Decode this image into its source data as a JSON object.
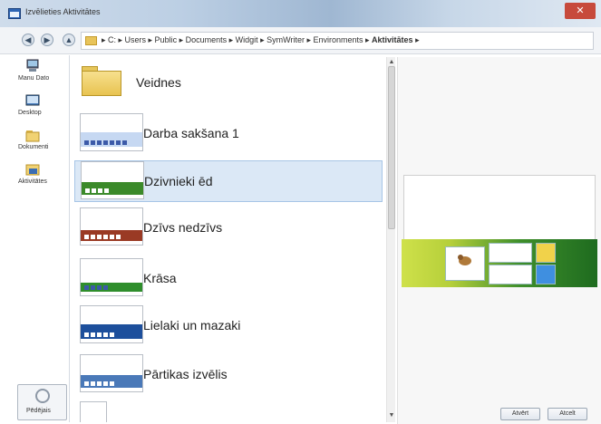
{
  "window": {
    "title": "Izvēlieties Aktivitātes",
    "close_label": "✕"
  },
  "nav": {
    "back_icon": "back-arrow-icon",
    "forward_icon": "forward-arrow-icon",
    "up_icon": "up-arrow-icon",
    "breadcrumb": [
      "C:",
      "Users",
      "Public",
      "Documents",
      "Widgit",
      "SymWriter",
      "Environments",
      "Aktivitātes"
    ],
    "path_text": "▸ C: ▸ Users ▸ Public ▸ Documents ▸ Widgit ▸ SymWriter ▸ Environments ▸ ",
    "current": "Aktivitātes",
    "trailing": " ▸"
  },
  "sidebar": {
    "items": [
      {
        "label": "Manu Dato",
        "icon": "computer-icon"
      },
      {
        "label": "Desktop",
        "icon": "desktop-icon"
      },
      {
        "label": "Dokumenti",
        "icon": "documents-folder-icon"
      },
      {
        "label": "Aktivitātes",
        "icon": "activities-icon"
      }
    ],
    "bottom_label": "Pēdējais"
  },
  "files": [
    {
      "label": "Veidnes",
      "type": "folder"
    },
    {
      "label": "Darba sakšana 1",
      "type": "file",
      "band": "#c6d8f2"
    },
    {
      "label": "Dzivnieki ēd",
      "type": "file",
      "band": "#3b8a2a",
      "selected": true
    },
    {
      "label": "Dzīvs nedzīvs",
      "type": "file",
      "band": "#9a3a24"
    },
    {
      "label": "Krāsa",
      "type": "file",
      "band": "#2f8e2c"
    },
    {
      "label": "Lielaki un mazaki",
      "type": "file",
      "band": "#1d4f9c"
    },
    {
      "label": "Pārtikas izvēlis",
      "type": "file",
      "band": "#4a79b8"
    },
    {
      "label": "",
      "type": "file",
      "band": "#d9d9d9"
    }
  ],
  "buttons": {
    "open": "Atvērt",
    "cancel": "Atcelt"
  },
  "colors": {
    "selection": "#dbe8f6",
    "accent": "#2f66b4"
  }
}
